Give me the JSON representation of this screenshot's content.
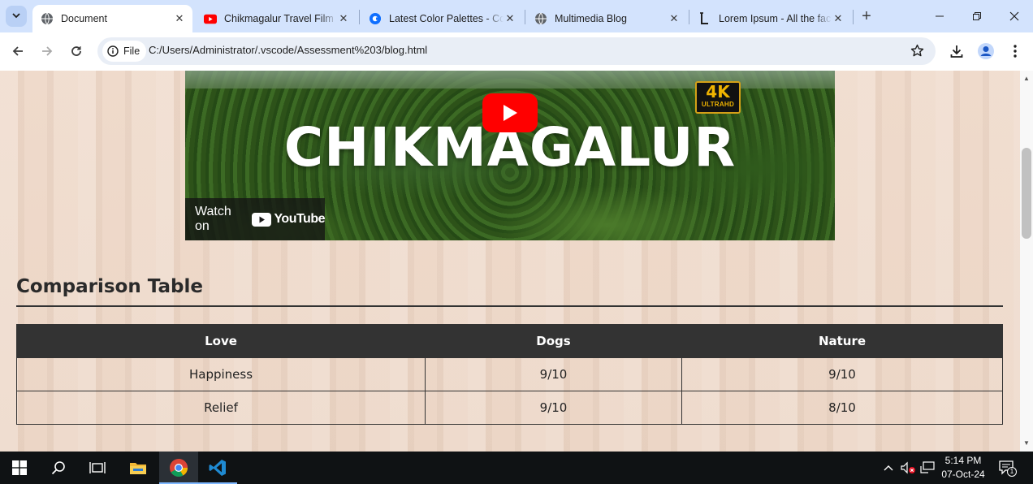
{
  "browser": {
    "tabs": [
      {
        "title": "Document",
        "active": true,
        "favicon": "globe-icon"
      },
      {
        "title": "Chikmagalur Travel Film | Karnataka",
        "active": false,
        "favicon": "youtube-icon"
      },
      {
        "title": "Latest Color Palettes - Coolors",
        "active": false,
        "favicon": "coolors-icon"
      },
      {
        "title": "Multimedia Blog",
        "active": false,
        "favicon": "globe-icon"
      },
      {
        "title": "Lorem Ipsum - All the facts",
        "active": false,
        "favicon": "lipsum-icon"
      }
    ],
    "address": {
      "chip_label": "File",
      "url": "C:/Users/Administrator/.vscode/Assessment%203/blog.html"
    }
  },
  "page": {
    "video": {
      "title": "CHIKMAGALUR",
      "badge_big": "4K",
      "badge_small": "ULTRAHD",
      "watch_on": "Watch on",
      "youtube_word": "YouTube"
    },
    "section_title": "Comparison Table",
    "table": {
      "headers": [
        "Love",
        "Dogs",
        "Nature"
      ],
      "rows": [
        [
          "Happiness",
          "9/10",
          "9/10"
        ],
        [
          "Relief",
          "9/10",
          "8/10"
        ]
      ]
    }
  },
  "taskbar": {
    "time": "5:14 PM",
    "date": "07-Oct-24",
    "notification_count": "1"
  },
  "colors": {
    "tabstrip": "#d3e3fd",
    "page_background": "#f0dccd",
    "table_header": "#333333",
    "youtube_red": "#ff0000"
  }
}
